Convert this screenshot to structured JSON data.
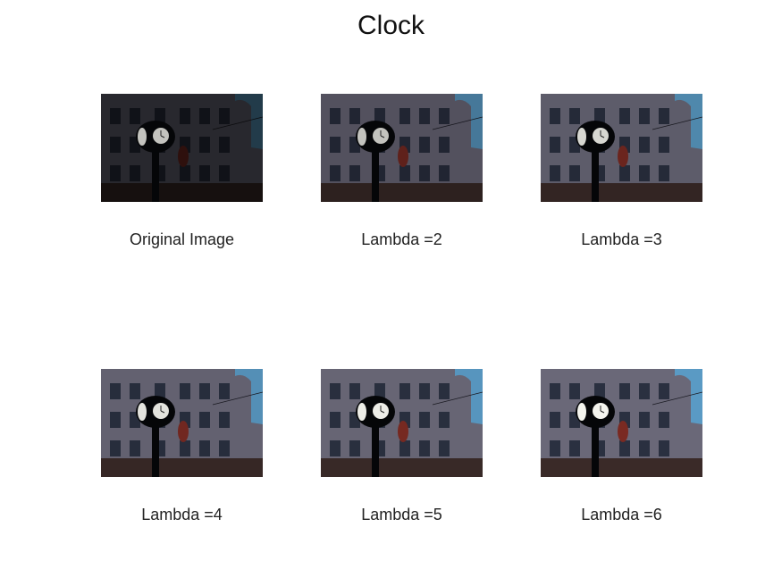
{
  "figure": {
    "title": "Clock"
  },
  "panels": [
    {
      "caption": "Original Image",
      "brightness": 0.38
    },
    {
      "caption": "Lambda =2",
      "brightness": 0.78
    },
    {
      "caption": "Lambda =3",
      "brightness": 0.88
    },
    {
      "caption": "Lambda =4",
      "brightness": 0.93
    },
    {
      "caption": "Lambda =5",
      "brightness": 0.97
    },
    {
      "caption": "Lambda =6",
      "brightness": 1.0
    }
  ],
  "colors": {
    "sky": "#5a9ac4",
    "building": "#6a6878",
    "window": "#2a3040",
    "clock_face": "#f4f4ee",
    "silhouette": "#050608"
  }
}
